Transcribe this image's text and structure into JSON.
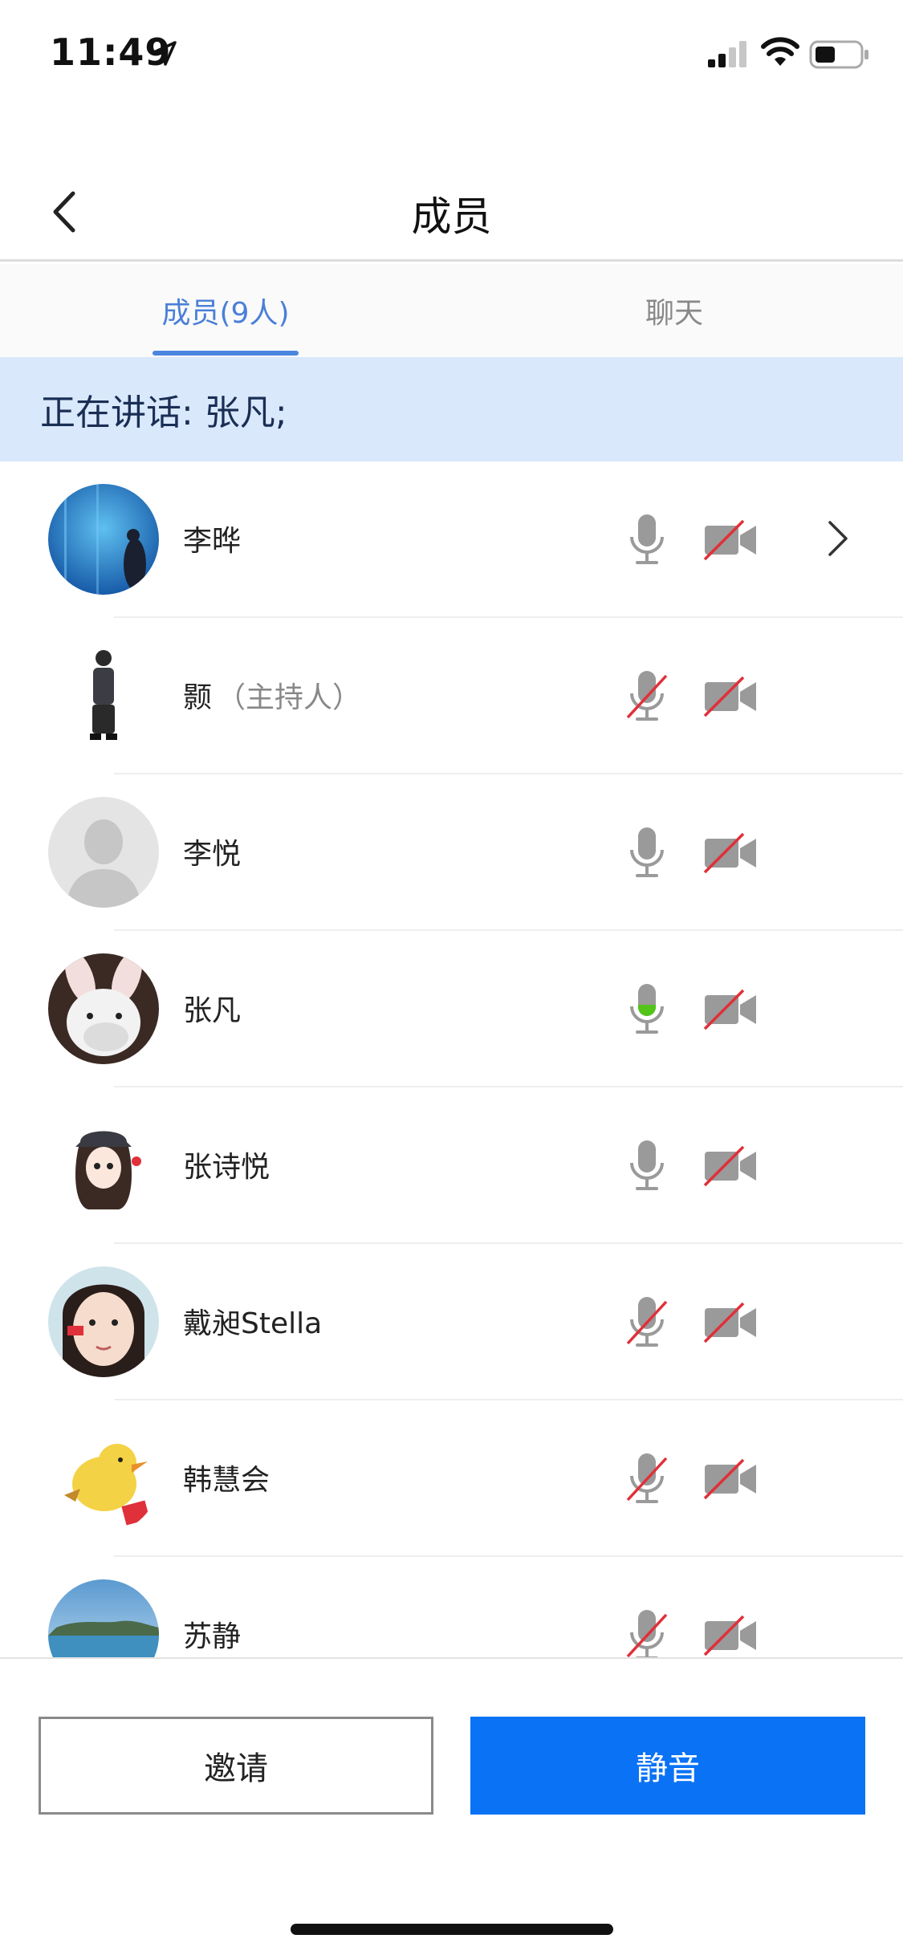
{
  "status_bar": {
    "time": "11:49"
  },
  "header": {
    "title": "成员",
    "back_icon": "chevron-left-icon"
  },
  "tabs": [
    {
      "label": "成员(9人)",
      "active": true
    },
    {
      "label": "聊天",
      "active": false
    }
  ],
  "speaking": {
    "label": "正在讲话:",
    "names": "张凡;"
  },
  "members": [
    {
      "name": "李晔",
      "role": "",
      "mic": "on",
      "camera": "off",
      "chevron": true
    },
    {
      "name": "颢",
      "role": "（主持人）",
      "mic": "muted",
      "camera": "off",
      "chevron": false
    },
    {
      "name": "李悦",
      "role": "",
      "mic": "on",
      "camera": "off",
      "chevron": false
    },
    {
      "name": "张凡",
      "role": "",
      "mic": "speaking",
      "camera": "off",
      "chevron": false
    },
    {
      "name": "张诗悦",
      "role": "",
      "mic": "on",
      "camera": "off",
      "chevron": false
    },
    {
      "name": "戴昶Stella",
      "role": "",
      "mic": "muted",
      "camera": "off",
      "chevron": false
    },
    {
      "name": "韩慧会",
      "role": "",
      "mic": "muted",
      "camera": "off",
      "chevron": false
    },
    {
      "name": "苏静",
      "role": "",
      "mic": "muted",
      "camera": "off",
      "chevron": false
    }
  ],
  "actions": {
    "invite_label": "邀请",
    "mute_label": "静音"
  },
  "colors": {
    "accent": "#0a72f5",
    "tab_active": "#4a7fd8",
    "banner_bg": "#d9e8fb",
    "speaking_green": "#52c41a",
    "muted_red": "#e0303a"
  }
}
